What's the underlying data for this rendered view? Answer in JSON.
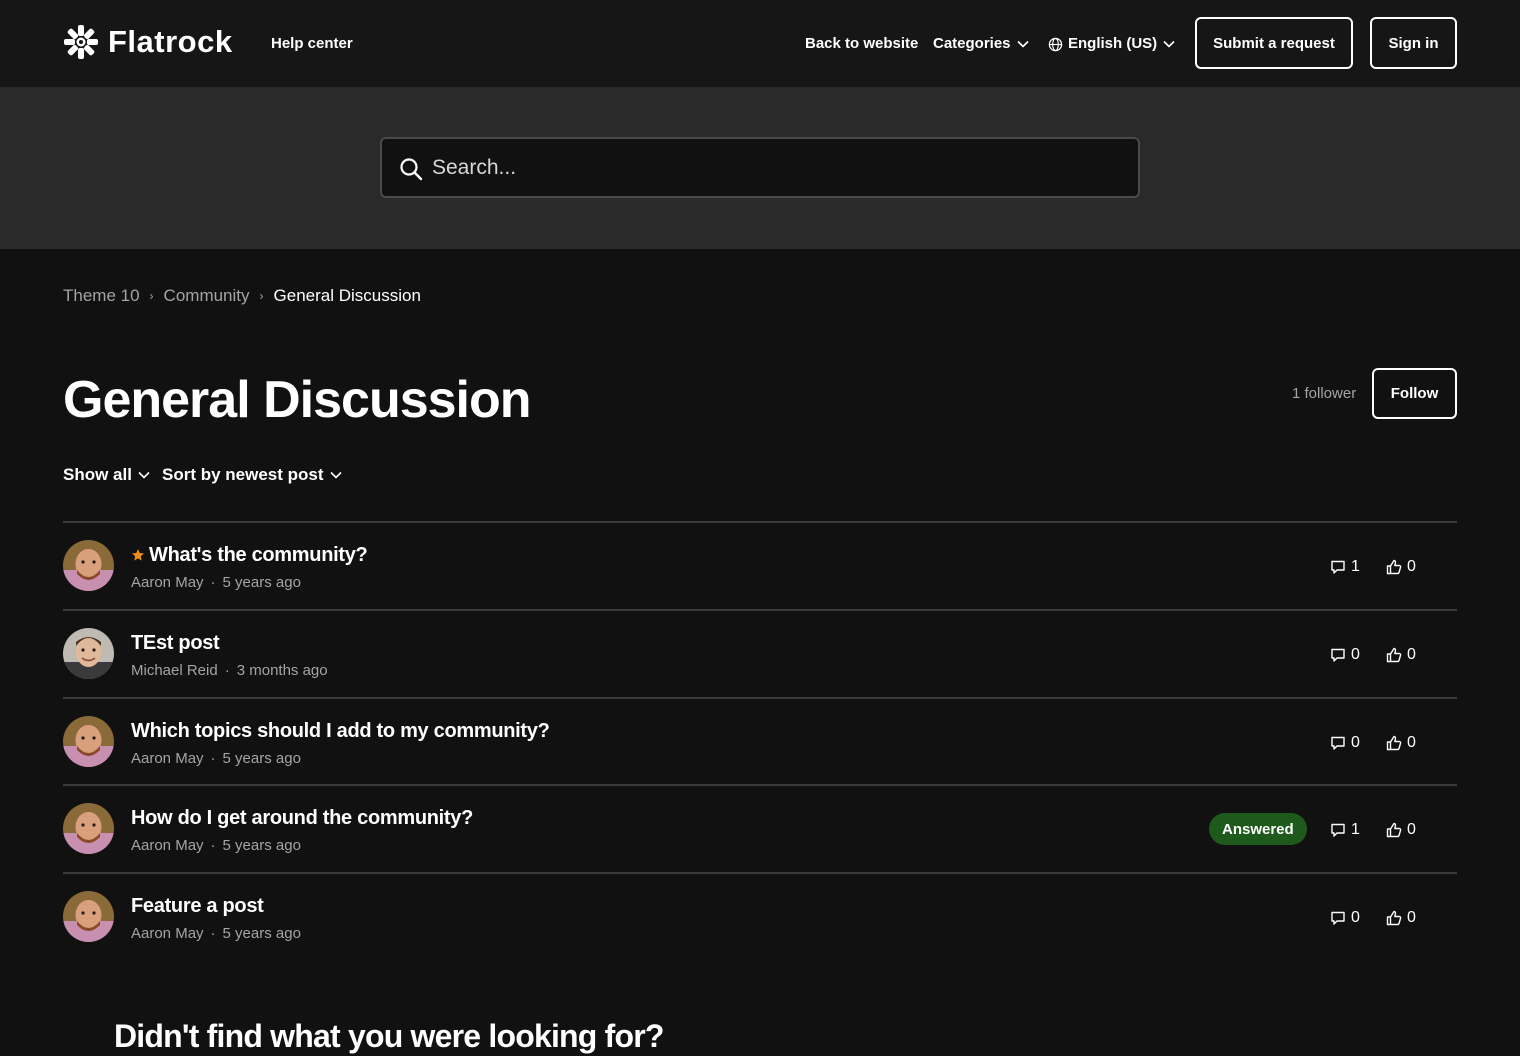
{
  "header": {
    "brand": "Flatrock",
    "help_center": "Help center",
    "nav": {
      "back": "Back to website",
      "categories": "Categories",
      "language": "English (US)"
    },
    "submit_request": "Submit a request",
    "sign_in": "Sign in"
  },
  "search": {
    "placeholder": "Search..."
  },
  "breadcrumb": [
    "Theme 10",
    "Community",
    "General Discussion"
  ],
  "topic": {
    "title": "General Discussion",
    "followers": "1 follower",
    "follow_label": "Follow"
  },
  "filters": {
    "show": "Show all",
    "sort": "Sort by newest post"
  },
  "posts": [
    {
      "title": "What's the community?",
      "author": "Aaron May",
      "time": "5 years ago",
      "featured": true,
      "answered": false,
      "comments": "1",
      "votes": "0"
    },
    {
      "title": "TEst post",
      "author": "Michael Reid",
      "time": "3 months ago",
      "featured": false,
      "answered": false,
      "comments": "0",
      "votes": "0"
    },
    {
      "title": "Which topics should I add to my community?",
      "author": "Aaron May",
      "time": "5 years ago",
      "featured": false,
      "answered": false,
      "comments": "0",
      "votes": "0"
    },
    {
      "title": "How do I get around the community?",
      "author": "Aaron May",
      "time": "5 years ago",
      "featured": false,
      "answered": true,
      "comments": "1",
      "votes": "0"
    },
    {
      "title": "Feature a post",
      "author": "Aaron May",
      "time": "5 years ago",
      "featured": false,
      "answered": false,
      "comments": "0",
      "votes": "0"
    }
  ],
  "answered_label": "Answered",
  "meta_separator": "·",
  "cta": {
    "title": "Didn't find what you were looking for?"
  },
  "colors": {
    "background": "#111111",
    "header": "#161616",
    "search_band": "#2a2a2a",
    "muted_text": "#a4a4a4",
    "answered_badge": "#1e5a1c",
    "featured_star": "#f08c1c"
  },
  "icons": [
    "flatrock-logo-icon",
    "chevron-down-icon",
    "globe-icon",
    "search-icon",
    "star-icon",
    "comment-icon",
    "thumbs-up-icon",
    "avatar"
  ]
}
